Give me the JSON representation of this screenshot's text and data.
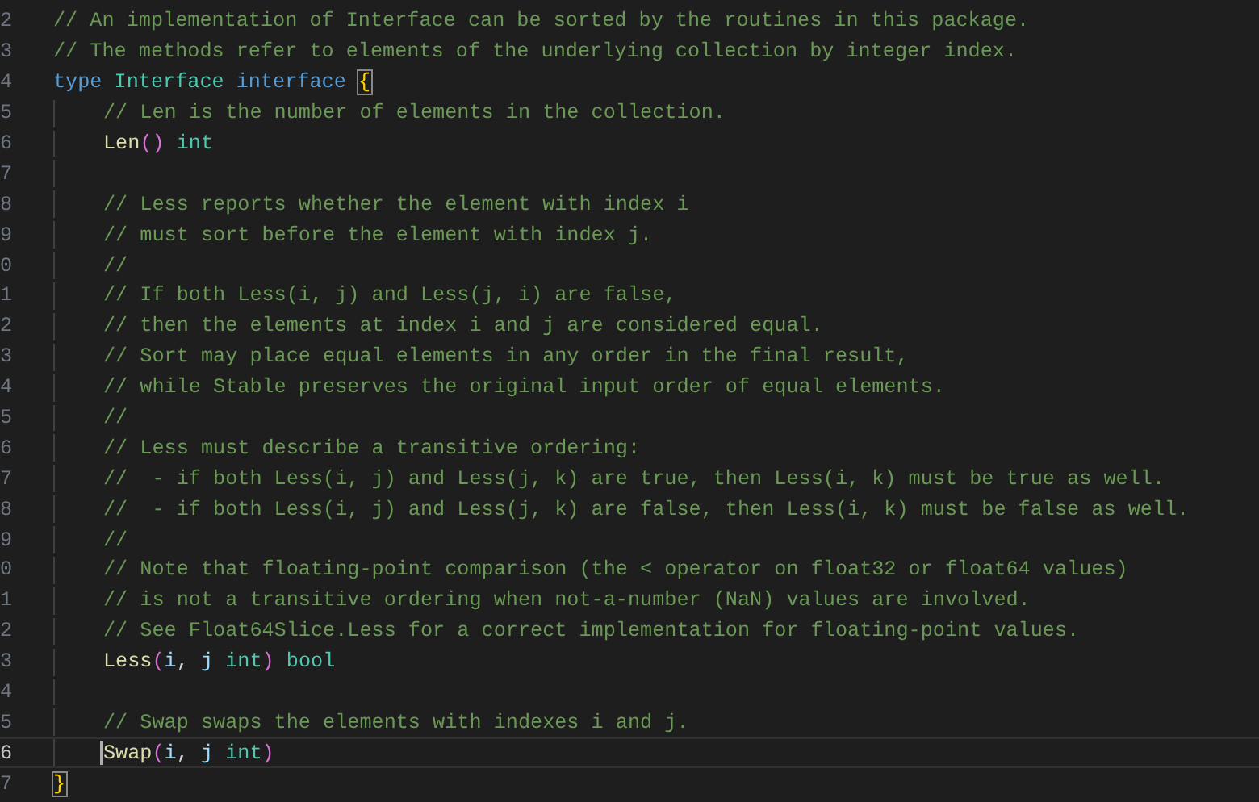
{
  "editor": {
    "lines": [
      {
        "number": "2",
        "indented": false,
        "current": false,
        "tokens": [
          {
            "kind": "comment",
            "text": "// An implementation of Interface can be sorted by the routines in this package."
          }
        ]
      },
      {
        "number": "3",
        "indented": false,
        "current": false,
        "tokens": [
          {
            "kind": "comment",
            "text": "// The methods refer to elements of the underlying collection by integer index."
          }
        ]
      },
      {
        "number": "4",
        "indented": false,
        "current": false,
        "tokens": [
          {
            "kind": "keyword",
            "text": "type "
          },
          {
            "kind": "type",
            "text": "Interface "
          },
          {
            "kind": "keyword",
            "text": "interface "
          },
          {
            "kind": "brace",
            "text": "{",
            "matched": true
          }
        ]
      },
      {
        "number": "5",
        "indented": true,
        "current": false,
        "tokens": [
          {
            "kind": "comment",
            "text": "// Len is the number of elements in the collection."
          }
        ]
      },
      {
        "number": "6",
        "indented": true,
        "current": false,
        "tokens": [
          {
            "kind": "func",
            "text": "Len"
          },
          {
            "kind": "paren",
            "text": "() "
          },
          {
            "kind": "type",
            "text": "int"
          }
        ]
      },
      {
        "number": "7",
        "indented": true,
        "current": false
      },
      {
        "number": "8",
        "indented": true,
        "current": false,
        "tokens": [
          {
            "kind": "comment",
            "text": "// Less reports whether the element with index i"
          }
        ]
      },
      {
        "number": "9",
        "indented": true,
        "current": false,
        "tokens": [
          {
            "kind": "comment",
            "text": "// must sort before the element with index j."
          }
        ]
      },
      {
        "number": "0",
        "indented": true,
        "current": false,
        "tokens": [
          {
            "kind": "comment",
            "text": "//"
          }
        ]
      },
      {
        "number": "1",
        "indented": true,
        "current": false,
        "tokens": [
          {
            "kind": "comment",
            "text": "// If both Less(i, j) and Less(j, i) are false,"
          }
        ]
      },
      {
        "number": "2",
        "indented": true,
        "current": false,
        "tokens": [
          {
            "kind": "comment",
            "text": "// then the elements at index i and j are considered equal."
          }
        ]
      },
      {
        "number": "3",
        "indented": true,
        "current": false,
        "tokens": [
          {
            "kind": "comment",
            "text": "// Sort may place equal elements in any order in the final result,"
          }
        ]
      },
      {
        "number": "4",
        "indented": true,
        "current": false,
        "tokens": [
          {
            "kind": "comment",
            "text": "// while Stable preserves the original input order of equal elements."
          }
        ]
      },
      {
        "number": "5",
        "indented": true,
        "current": false,
        "tokens": [
          {
            "kind": "comment",
            "text": "//"
          }
        ]
      },
      {
        "number": "6",
        "indented": true,
        "current": false,
        "tokens": [
          {
            "kind": "comment",
            "text": "// Less must describe a transitive ordering:"
          }
        ]
      },
      {
        "number": "7",
        "indented": true,
        "current": false,
        "tokens": [
          {
            "kind": "comment",
            "text": "//  - if both Less(i, j) and Less(j, k) are true, then Less(i, k) must be true as well."
          }
        ]
      },
      {
        "number": "8",
        "indented": true,
        "current": false,
        "tokens": [
          {
            "kind": "comment",
            "text": "//  - if both Less(i, j) and Less(j, k) are false, then Less(i, k) must be false as well."
          }
        ]
      },
      {
        "number": "9",
        "indented": true,
        "current": false,
        "tokens": [
          {
            "kind": "comment",
            "text": "//"
          }
        ]
      },
      {
        "number": "0",
        "indented": true,
        "current": false,
        "tokens": [
          {
            "kind": "comment",
            "text": "// Note that floating-point comparison (the < operator on float32 or float64 values)"
          }
        ]
      },
      {
        "number": "1",
        "indented": true,
        "current": false,
        "tokens": [
          {
            "kind": "comment",
            "text": "// is not a transitive ordering when not-a-number (NaN) values are involved."
          }
        ]
      },
      {
        "number": "2",
        "indented": true,
        "current": false,
        "tokens": [
          {
            "kind": "comment",
            "text": "// See Float64Slice.Less for a correct implementation for floating-point values."
          }
        ]
      },
      {
        "number": "3",
        "indented": true,
        "current": false,
        "tokens": [
          {
            "kind": "func",
            "text": "Less"
          },
          {
            "kind": "paren",
            "text": "("
          },
          {
            "kind": "param",
            "text": "i"
          },
          {
            "kind": "plain",
            "text": ", "
          },
          {
            "kind": "param",
            "text": "j "
          },
          {
            "kind": "type",
            "text": "int"
          },
          {
            "kind": "paren",
            "text": ") "
          },
          {
            "kind": "type",
            "text": "bool"
          }
        ]
      },
      {
        "number": "4",
        "indented": true,
        "current": false
      },
      {
        "number": "5",
        "indented": true,
        "current": false,
        "tokens": [
          {
            "kind": "comment",
            "text": "// Swap swaps the elements with indexes i and j."
          }
        ]
      },
      {
        "number": "6",
        "indented": true,
        "current": true,
        "tokens": [
          {
            "kind": "func",
            "text": "Swap"
          },
          {
            "kind": "paren",
            "text": "("
          },
          {
            "kind": "param",
            "text": "i"
          },
          {
            "kind": "plain",
            "text": ", "
          },
          {
            "kind": "param",
            "text": "j "
          },
          {
            "kind": "type",
            "text": "int"
          },
          {
            "kind": "paren",
            "text": ")"
          }
        ]
      },
      {
        "number": "7",
        "indented": false,
        "current": false,
        "tokens": [
          {
            "kind": "brace",
            "text": "}",
            "matched": true
          }
        ]
      }
    ]
  }
}
